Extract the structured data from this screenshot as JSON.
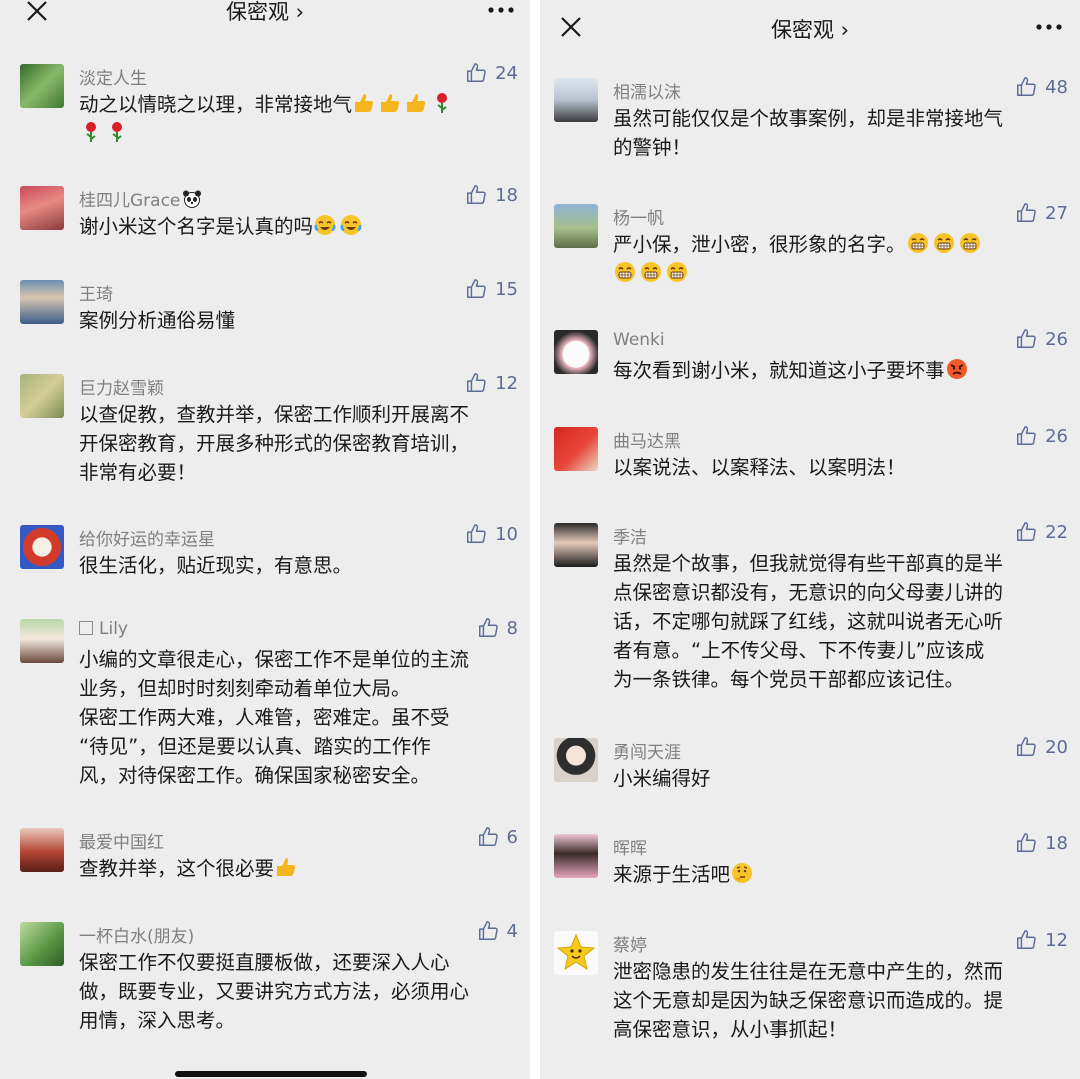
{
  "left": {
    "title": "保密观 ›",
    "comments": [
      {
        "name": "淡定人生",
        "likes": "24",
        "text": "动之以情晓之以理，非常接地气"
      },
      {
        "name": "桂四儿Grace",
        "likes": "18",
        "text": "谢小米这个名字是认真的吗"
      },
      {
        "name": "王琦",
        "likes": "15",
        "text": "案例分析通俗易懂"
      },
      {
        "name": "巨力赵雪颖",
        "likes": "12",
        "text": "以查促教，查教并举，保密工作顺利开展离不\n开保密教育，开展多种形式的保密教育培训，\n非常有必要！"
      },
      {
        "name": "给你好运的幸运星",
        "likes": "10",
        "text": "很生活化，贴近现实，有意思。"
      },
      {
        "name": "Lily",
        "likes": "8",
        "text": "小编的文章很走心，保密工作不是单位的主流\n业务，但却时时刻刻牵动着单位大局。\n保密工作两大难，人难管，密难定。虽不受\n“待见”，但还是要以认真、踏实的工作作\n风，对待保密工作。确保国家秘密安全。"
      },
      {
        "name": "最爱中国红",
        "likes": "6",
        "text": "查教并举，这个很必要"
      },
      {
        "name": "一杯白水(朋友)",
        "likes": "4",
        "text": "保密工作不仅要挺直腰板做，还要深入人心\n做，既要专业，又要讲究方式方法，必须用心\n用情，深入思考。"
      }
    ]
  },
  "right": {
    "title": "保密观 ›",
    "comments": [
      {
        "name": "相濡以沫",
        "likes": "48",
        "text": "虽然可能仅仅是个故事案例，却是非常接地气\n的警钟！"
      },
      {
        "name": "杨一帆",
        "likes": "27",
        "text": "严小保，泄小密，很形象的名字。"
      },
      {
        "name": "Wenki",
        "likes": "26",
        "text": "每次看到谢小米，就知道这小子要坏事"
      },
      {
        "name": "曲马达黑",
        "likes": "26",
        "text": "以案说法、以案释法、以案明法！"
      },
      {
        "name": "季洁",
        "likes": "22",
        "text": "虽然是个故事，但我就觉得有些干部真的是半\n点保密意识都没有，无意识的向父母妻儿讲的\n话，不定哪句就踩了红线，这就叫说者无心听\n者有意。“上不传父母、下不传妻儿”应该成\n为一条铁律。每个党员干部都应该记住。"
      },
      {
        "name": "勇闯天涯",
        "likes": "20",
        "text": "小米编得好"
      },
      {
        "name": "晖晖",
        "likes": "18",
        "text": "来源于生活吧"
      },
      {
        "name": "蔡婷",
        "likes": "12",
        "text": "泄密隐患的发生往往是在无意中产生的，然而\n这个无意却是因为缺乏保密意识而造成的。提\n高保密意识，从小事抓起！"
      }
    ]
  },
  "colors": {
    "background": "#ededed",
    "username": "#7f7f7f",
    "like": "#5c6c94",
    "text": "#1a1a1a"
  }
}
